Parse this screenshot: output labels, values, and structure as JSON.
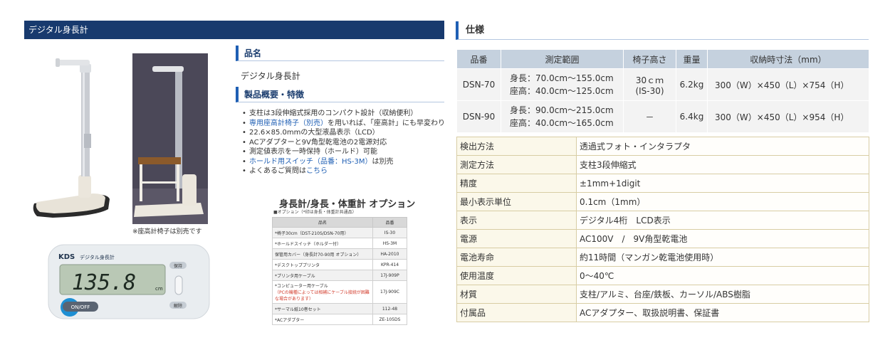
{
  "left": {
    "title": "デジタル身長計",
    "caption": "※座高計椅子は別売です",
    "lcd": {
      "brand": "KDS",
      "model": "デジタル身長計",
      "reading": "135.8",
      "unit": "cm",
      "btn_top": "保持",
      "btn_bottom": "解除",
      "power": "ON/OFF"
    },
    "name_heading": "品名",
    "product_name": "デジタル身長計",
    "overview_heading": "製品概要・特徴",
    "features": [
      {
        "text": "支柱は3段伸縮式採用のコンパクト設計（収納便利）"
      },
      {
        "link": "専用座高計椅子（別売）",
        "text": "を用いれば、「座高計」にも早変わり"
      },
      {
        "text": "22.6×85.0mmの大型液晶表示（LCD）"
      },
      {
        "text": "ACアダプターと9V角型乾電池の2電源対応"
      },
      {
        "text": "測定値表示を一時保持（ホールド）可能"
      },
      {
        "link": "ホールド用スイッチ（品番：HS-3M）",
        "text": "は別売"
      },
      {
        "text": "よくあるご質問は",
        "link_after": "こちら"
      }
    ],
    "options": {
      "title": "身長計/身長・体重計 オプション",
      "subtitle": "■オプション（*印は身長・体重計共通品）",
      "headers": [
        "品名",
        "品番"
      ],
      "rows": [
        {
          "name": "*椅子30cm（DST-210S/DSN-70用）",
          "code": "IS-30"
        },
        {
          "name": "*ホールドスイッチ（ホルダー付）",
          "code": "HS-3M"
        },
        {
          "name": "保管用カバー（身長計70-90用 オプション）",
          "code": "HA-2010"
        },
        {
          "name": "*デスクトッププリンタ",
          "code": "KPR-414"
        },
        {
          "name": "*プリンタ用ケーブル",
          "code": "17J-909P"
        },
        {
          "name": "*コンピューター用ケーブル",
          "note": "（PCの機種によっては相補にケーブル接続が困難な場合があります）",
          "code": "17J-909C"
        },
        {
          "name": "*サーマル紙10巻セット",
          "code": "112-48"
        },
        {
          "name": "*ACアダプター",
          "code": "ZE-105DS"
        }
      ]
    }
  },
  "spec": {
    "heading": "仕様",
    "headers": [
      "品番",
      "測定範囲",
      "椅子高さ",
      "重量",
      "収納時寸法（mm）"
    ],
    "models": [
      {
        "code": "DSN-70",
        "range1": "身長：70.0cm～155.0cm",
        "range2": "座高：40.0cm～125.0cm",
        "chair1": "30ｃｍ",
        "chair2": "(IS-30)",
        "weight": "6.2kg",
        "dims": "300（W）×450（L）×754（H）"
      },
      {
        "code": "DSN-90",
        "range1": "身長：90.0cm～215.0cm",
        "range2": "座高：40.0cm～165.0cm",
        "chair1": "－",
        "chair2": "",
        "weight": "6.4kg",
        "dims": "300（W）×450（L）×954（H）"
      }
    ],
    "details": [
      {
        "k": "検出方法",
        "v": "透過式フォト・インタラプタ"
      },
      {
        "k": "測定方法",
        "v": "支柱3段伸縮式"
      },
      {
        "k": "精度",
        "v": "±1mm+1digit"
      },
      {
        "k": "最小表示単位",
        "v": "0.1cm（1mm）"
      },
      {
        "k": "表示",
        "v": "デジタル4桁　LCD表示"
      },
      {
        "k": "電源",
        "v": "AC100V　/　9V角型乾電池"
      },
      {
        "k": "電池寿命",
        "v": "約11時間（マンガン乾電池使用時）"
      },
      {
        "k": "使用温度",
        "v": "0～40℃"
      },
      {
        "k": "材質",
        "v": "支柱/アルミ、台座/鉄板、カーソル/ABS樹脂"
      },
      {
        "k": "付属品",
        "v": "ACアダプター、取扱説明書、保証書"
      }
    ]
  }
}
